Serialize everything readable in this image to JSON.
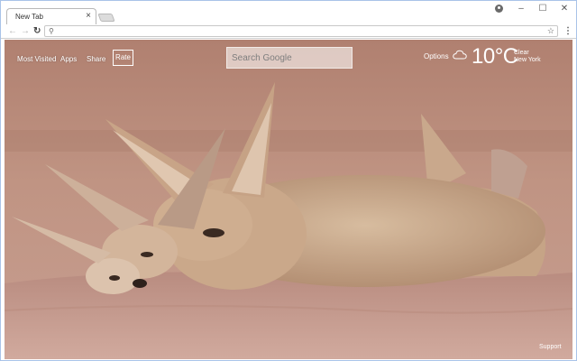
{
  "browser": {
    "tab_title": "New Tab",
    "tab_close": "×",
    "window_controls": {
      "minimize": "–",
      "maximize": "☐",
      "close": "✕"
    },
    "nav": {
      "back": "←",
      "forward": "→",
      "reload": "↻"
    },
    "omnibox": {
      "value": "",
      "search_glyph": "⚲"
    },
    "bookmark_glyph": "☆",
    "menu_glyph": "⋮"
  },
  "page": {
    "nav_links": [
      "Most Visited",
      "Apps",
      "Share"
    ],
    "rate_label": "Rate",
    "search_placeholder": "Search Google",
    "options_label": "Options",
    "weather": {
      "temperature": "10°C",
      "condition": "Clear",
      "location": "New York",
      "icon": "cloud-icon"
    },
    "support_label": "Support"
  },
  "colors": {
    "window_border": "#a9c3e8",
    "photo_sky": "#b98b78",
    "photo_rock": "#c59a8c",
    "fox_fur": "#c9a88a"
  }
}
